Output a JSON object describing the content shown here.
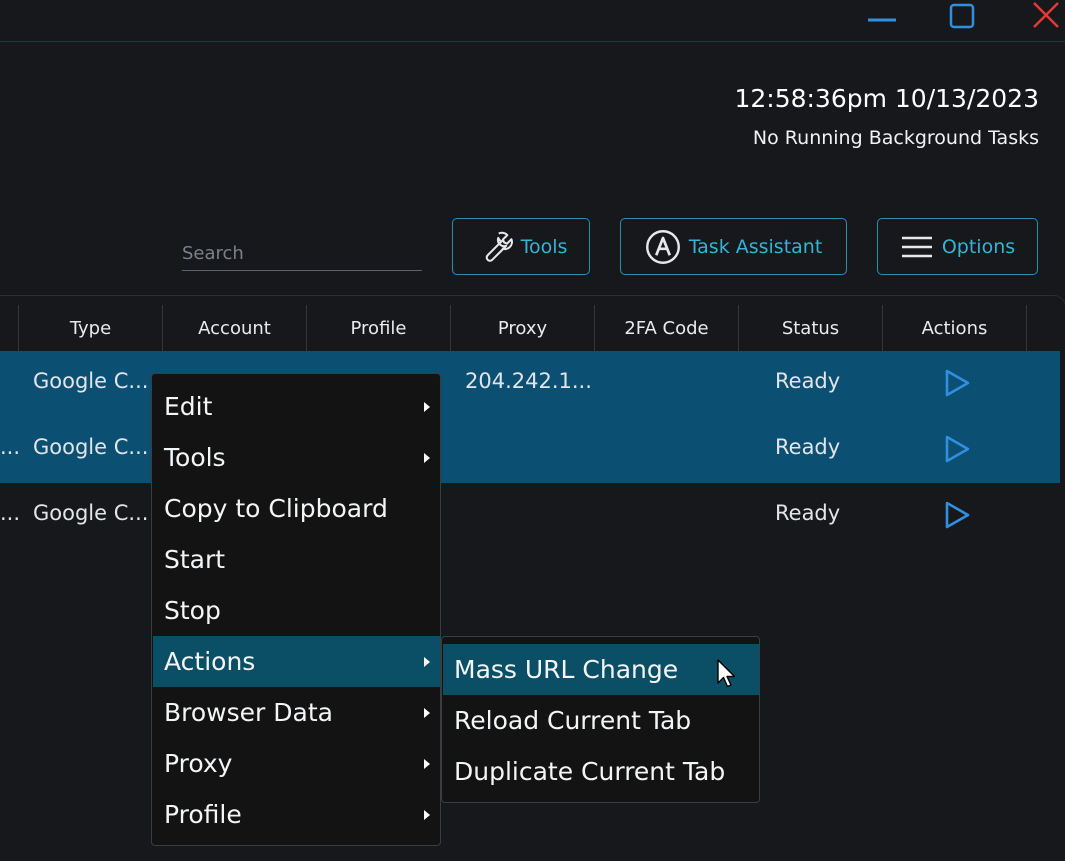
{
  "window": {
    "minimize_icon": "minimize-icon",
    "maximize_icon": "maximize-icon",
    "close_icon": "close-icon"
  },
  "header": {
    "clock": "12:58:36pm 10/13/2023",
    "background_tasks": "No Running Background Tasks"
  },
  "search": {
    "placeholder": "Search",
    "value": ""
  },
  "toolbar": {
    "tools_label": "Tools",
    "task_assistant_label": "Task Assistant",
    "options_label": "Options"
  },
  "table": {
    "columns": [
      "Type",
      "Account",
      "Profile",
      "Proxy",
      "2FA Code",
      "Status",
      "Actions"
    ],
    "rows": [
      {
        "prefix": "",
        "type": "Google C...",
        "proxy": "204.242.1...",
        "status": "Ready",
        "selected": true
      },
      {
        "prefix": "...",
        "type": "Google C...",
        "proxy": "",
        "status": "Ready",
        "selected": true
      },
      {
        "prefix": "...",
        "type": "Google C...",
        "proxy": "",
        "status": "Ready",
        "selected": false
      }
    ]
  },
  "context_menu": {
    "items": [
      {
        "label": "Edit",
        "has_submenu": true
      },
      {
        "label": "Tools",
        "has_submenu": true
      },
      {
        "label": "Copy to Clipboard",
        "has_submenu": false
      },
      {
        "label": "Start",
        "has_submenu": false
      },
      {
        "label": "Stop",
        "has_submenu": false
      },
      {
        "label": "Actions",
        "has_submenu": true,
        "active": true
      },
      {
        "label": "Browser Data",
        "has_submenu": true
      },
      {
        "label": "Proxy",
        "has_submenu": true
      },
      {
        "label": "Profile",
        "has_submenu": true
      }
    ]
  },
  "actions_submenu": {
    "items": [
      {
        "label": "Mass URL Change",
        "active": true
      },
      {
        "label": "Reload Current Tab"
      },
      {
        "label": "Duplicate Current Tab"
      }
    ]
  },
  "colors": {
    "accent": "#35b4d3",
    "selection": "#0b4f73",
    "menu_highlight": "#0b4f66",
    "close_red": "#e53935",
    "play_blue": "#2f8fe0"
  }
}
